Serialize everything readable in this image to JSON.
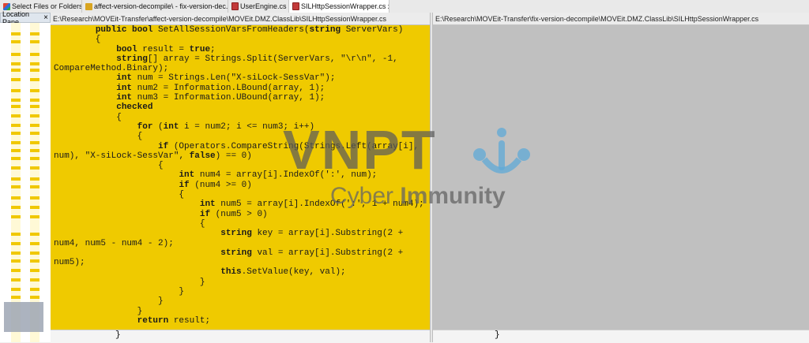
{
  "tabs": [
    {
      "label": "Select Files or Folders",
      "icon": "select-files-icon",
      "active": false
    },
    {
      "label": "affect-version-decompile\\ - fix-version-dec...",
      "icon": "folder-compare-icon",
      "active": false
    },
    {
      "label": "UserEngine.cs x 2",
      "icon": "file-compare-icon",
      "active": false
    },
    {
      "label": "SILHttpSessionWrapper.cs x 2",
      "icon": "file-compare-icon",
      "active": true
    }
  ],
  "location_pane": {
    "title": "Location Pane",
    "close": "×"
  },
  "left_panel": {
    "path": "E:\\Research\\MOVEit-Transfer\\affect-version-decompile\\MOVEit.DMZ.ClassLib\\SILHttpSessionWrapper.cs",
    "lines": [
      "        public bool SetAllSessionVarsFromHeaders(string ServerVars)",
      "        {",
      "            bool result = true;",
      "            string[] array = Strings.Split(ServerVars, \"\\r\\n\", -1,",
      "CompareMethod.Binary);",
      "            int num = Strings.Len(\"X-siLock-SessVar\");",
      "            int num2 = Information.LBound(array, 1);",
      "            int num3 = Information.UBound(array, 1);",
      "            checked",
      "            {",
      "                for (int i = num2; i <= num3; i++)",
      "                {",
      "                    if (Operators.CompareString(Strings.Left(array[i],",
      "num), \"X-siLock-SessVar\", false) == 0)",
      "                    {",
      "                        int num4 = array[i].IndexOf(':', num);",
      "                        if (num4 >= 0)",
      "                        {",
      "                            int num5 = array[i].IndexOf(':', 1 + num4);",
      "                            if (num5 > 0)",
      "                            {",
      "                                string key = array[i].Substring(2 +",
      "num4, num5 - num4 - 2);",
      "                                string val = array[i].Substring(2 +",
      "num5);",
      "                                this.SetValue(key, val);",
      "                            }",
      "                        }",
      "                    }",
      "                }",
      "                return result;"
    ],
    "trailing_brace": "}",
    "highlight_color": "#efca00"
  },
  "right_panel": {
    "path": "E:\\Research\\MOVEit-Transfer\\fix-version-decompile\\MOVEit.DMZ.ClassLib\\SILHttpSessionWrapper.cs",
    "trailing_brace": "}",
    "background_color": "#c0c0c0"
  },
  "watermark": {
    "brand": "VNPT",
    "tagline_light": "Cyber",
    "tagline_bold": "Immunity",
    "logo_icon": "vnpt-logo-icon"
  }
}
